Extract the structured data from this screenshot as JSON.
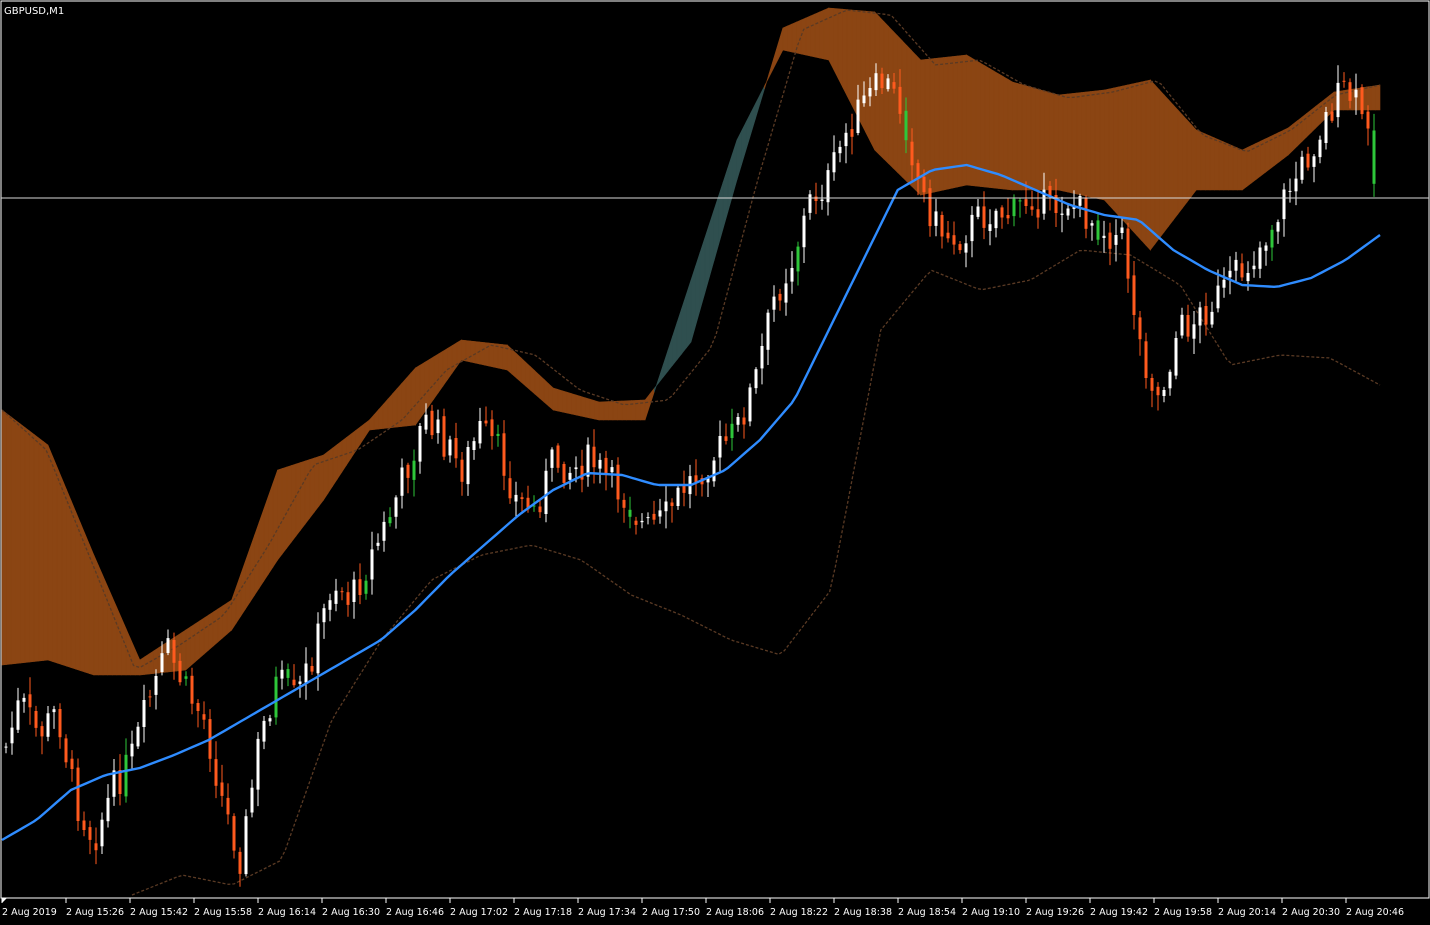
{
  "window": {
    "symbol_label": "GBPUSD,M1"
  },
  "colors": {
    "background": "#000000",
    "frame": "#ffffff",
    "candle_up": "#ffffff",
    "candle_down": "#ff5a1e",
    "candle_green": "#2ec73a",
    "ma_line": "#2f8cff",
    "bullish_band": "#2f4f4f",
    "bearish_band": "#8b4513",
    "band_edge": "#5a3a24",
    "price_line": "#d9d9d9"
  },
  "chart_data": {
    "type": "candlestick",
    "symbol": "GBPUSD",
    "timeframe": "M1",
    "x_tick_labels": [
      "2 Aug 2019",
      "2 Aug 15:26",
      "2 Aug 15:42",
      "2 Aug 15:58",
      "2 Aug 16:14",
      "2 Aug 16:30",
      "2 Aug 16:46",
      "2 Aug 17:02",
      "2 Aug 17:18",
      "2 Aug 17:34",
      "2 Aug 17:50",
      "2 Aug 18:06",
      "2 Aug 18:22",
      "2 Aug 18:38",
      "2 Aug 18:54",
      "2 Aug 19:10",
      "2 Aug 19:26",
      "2 Aug 19:42",
      "2 Aug 19:58",
      "2 Aug 20:14",
      "2 Aug 20:30",
      "2 Aug 20:46"
    ],
    "close_anchors": [
      760,
      700,
      735,
      710,
      800,
      840,
      790,
      760,
      700,
      650,
      690,
      720,
      800,
      860,
      740,
      680,
      700,
      650,
      580,
      600,
      560,
      520,
      470,
      420,
      440,
      470,
      430,
      450,
      500,
      510,
      460,
      470,
      460,
      480,
      500,
      530,
      520,
      490,
      470,
      450,
      430,
      380,
      300,
      260,
      200,
      180,
      130,
      100,
      80,
      110,
      190,
      230,
      240,
      220,
      210,
      215,
      195,
      210,
      200,
      215,
      230,
      240,
      350,
      400,
      330,
      320,
      300,
      280,
      260,
      230,
      190,
      160,
      120,
      90,
      110,
      195
    ],
    "ma_anchors": [
      840,
      820,
      790,
      775,
      768,
      755,
      740,
      720,
      700,
      680,
      660,
      640,
      610,
      575,
      545,
      515,
      490,
      473,
      475,
      485,
      485,
      470,
      440,
      400,
      330,
      260,
      190,
      170,
      165,
      175,
      190,
      205,
      215,
      220,
      250,
      270,
      285,
      287,
      278,
      260,
      235
    ],
    "upper_band_anchors": [
      410,
      450,
      560,
      670,
      645,
      615,
      545,
      465,
      450,
      420,
      370,
      345,
      355,
      390,
      405,
      400,
      345,
      180,
      30,
      10,
      15,
      65,
      60,
      85,
      98,
      92,
      80,
      135,
      152,
      130,
      95,
      85
    ],
    "lower_band_anchors": [
      895,
      875,
      885,
      860,
      720,
      640,
      580,
      555,
      545,
      560,
      595,
      615,
      640,
      655,
      590,
      330,
      270,
      290,
      280,
      250,
      255,
      285,
      365,
      355,
      358,
      385
    ],
    "cloud_top_anchors": [
      410,
      445,
      555,
      660,
      630,
      600,
      470,
      455,
      420,
      368,
      340,
      345,
      388,
      402,
      400,
      342,
      180,
      28,
      8,
      12,
      60,
      55,
      82,
      95,
      90,
      80,
      130,
      150,
      128,
      92,
      85
    ],
    "cloud_bottom_anchors": [
      665,
      660,
      675,
      675,
      670,
      630,
      560,
      500,
      430,
      425,
      360,
      370,
      410,
      420,
      420,
      280,
      140,
      50,
      60,
      150,
      195,
      185,
      190,
      190,
      200,
      250,
      190,
      190,
      155,
      110,
      110
    ],
    "price_line_level": 198,
    "series": [
      {
        "name": "",
        "kind": "moving-average"
      },
      {
        "name": "",
        "kind": "upper-band"
      },
      {
        "name": "",
        "kind": "lower-band"
      }
    ]
  }
}
